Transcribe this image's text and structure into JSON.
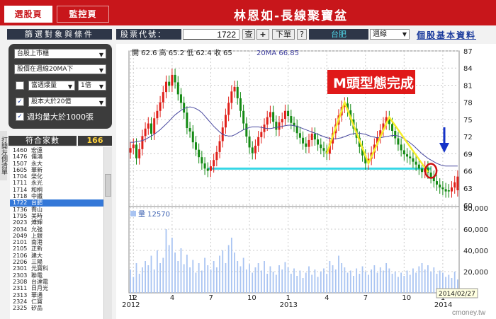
{
  "tabs": {
    "home": "選股頁",
    "monitor": "監控頁"
  },
  "app_title": "林恩如-長線聚寶盆",
  "toolbar": {
    "filter_header": "篩選對象與條件",
    "stock_label": "股票代號：",
    "stock_code": "1722",
    "query_button": "查",
    "add_button": "+",
    "order_button": "下單",
    "help_button": "?",
    "stock_name": "台肥",
    "period": "週線",
    "info_link": "個股基本資料"
  },
  "filters": {
    "market": "台股上市櫃",
    "price_condition": "股價在週線20MA下",
    "volume_option": "當週爆量",
    "volume_multiple": "1倍",
    "capital_option": "股本大於20億",
    "avg_volume_label": "週均量大於1000張"
  },
  "side_tab": "打開左側清單",
  "match": {
    "label": "符合家數",
    "count": "166"
  },
  "stock_list": [
    {
      "code": "1460",
      "name": "宏遠"
    },
    {
      "code": "1476",
      "name": "儒鴻"
    },
    {
      "code": "1507",
      "name": "永大"
    },
    {
      "code": "1605",
      "name": "華新"
    },
    {
      "code": "1704",
      "name": "榮化"
    },
    {
      "code": "1711",
      "name": "永光"
    },
    {
      "code": "1714",
      "name": "和桐"
    },
    {
      "code": "1718",
      "name": "中纖"
    },
    {
      "code": "1722",
      "name": "台肥"
    },
    {
      "code": "1736",
      "name": "喬山"
    },
    {
      "code": "1795",
      "name": "美時"
    },
    {
      "code": "2023",
      "name": "燁輝"
    },
    {
      "code": "2034",
      "name": "允強"
    },
    {
      "code": "2049",
      "name": "上銀"
    },
    {
      "code": "2101",
      "name": "南港"
    },
    {
      "code": "2105",
      "name": "正新"
    },
    {
      "code": "2106",
      "name": "建大"
    },
    {
      "code": "2206",
      "name": "三陽"
    },
    {
      "code": "2301",
      "name": "光寶科"
    },
    {
      "code": "2303",
      "name": "聯電"
    },
    {
      "code": "2308",
      "name": "台達電"
    },
    {
      "code": "2311",
      "name": "日月光"
    },
    {
      "code": "2313",
      "name": "華通"
    },
    {
      "code": "2324",
      "name": "仁寶"
    },
    {
      "code": "2325",
      "name": "矽品"
    }
  ],
  "selected_code": "1722",
  "quote": {
    "open": "開 62.6",
    "high": "高 65.2",
    "low": "低 62.4",
    "close": "收 65",
    "ma": "20MA 66.85"
  },
  "annotation": "M頭型態完成",
  "volume_label": "量 12570",
  "date_tooltip": "2014/02/27",
  "watermark": "cmoney.tw",
  "colors": {
    "up": "#e0201a",
    "down": "#138a13",
    "ma": "#4a4aa0",
    "support": "#36d7e6",
    "pattern": "#f5ee2a",
    "arrow": "#1533c8",
    "circle": "#cc1010",
    "volume": "#a9c4f2",
    "annotation_bg": "#e01919"
  },
  "chart_data": {
    "type": "candlestick",
    "price_axis": {
      "ticks": [
        60,
        63,
        66,
        69,
        72,
        75,
        78,
        81,
        84,
        87
      ],
      "range": [
        60,
        87
      ]
    },
    "volume_axis": {
      "ticks": [
        "0",
        "20,000",
        "40,000",
        "60,000",
        "80,000"
      ],
      "range": [
        0,
        80000
      ]
    },
    "x_tick_labels": [
      {
        "label": "12",
        "index": 0
      },
      {
        "label": "1",
        "index": 1
      },
      {
        "label": "4",
        "index": 14
      },
      {
        "label": "7",
        "index": 27
      },
      {
        "label": "10",
        "index": 40
      },
      {
        "label": "1",
        "index": 53
      },
      {
        "label": "4",
        "index": 66
      },
      {
        "label": "7",
        "index": 79
      },
      {
        "label": "10",
        "index": 92
      },
      {
        "label": "1",
        "index": 105
      }
    ],
    "year_labels": [
      {
        "label": "2012",
        "index": 0
      },
      {
        "label": "2013",
        "index": 53
      },
      {
        "label": "2014",
        "index": 105
      }
    ],
    "close": [
      70.0,
      70.6,
      68.2,
      69.8,
      72.1,
      73.4,
      74.3,
      72.5,
      75.2,
      76.5,
      78.0,
      79.8,
      81.6,
      80.9,
      82.8,
      81.5,
      79.4,
      77.9,
      76.2,
      73.5,
      72.9,
      71.0,
      69.7,
      68.4,
      67.3,
      66.4,
      66.0,
      66.8,
      67.9,
      69.3,
      71.2,
      73.6,
      75.8,
      77.9,
      79.9,
      80.7,
      78.7,
      76.5,
      74.3,
      72.0,
      70.1,
      69.1,
      70.4,
      71.9,
      72.8,
      74.1,
      75.4,
      76.3,
      74.6,
      73.2,
      74.5,
      75.1,
      76.5,
      75.6,
      74.4,
      73.9,
      72.6,
      71.8,
      70.8,
      70.2,
      71.4,
      72.5,
      71.5,
      70.6,
      70.0,
      69.5,
      69.0,
      70.8,
      72.6,
      74.1,
      75.7,
      77.2,
      77.8,
      76.6,
      75.0,
      73.4,
      71.8,
      70.2,
      68.7,
      67.3,
      68.1,
      69.2,
      70.6,
      71.9,
      73.1,
      74.3,
      75.4,
      74.2,
      73.0,
      71.7,
      70.6,
      69.6,
      68.9,
      68.5,
      68.2,
      67.6,
      67.1,
      66.4,
      65.8,
      66.6,
      65.7,
      64.9,
      64.2,
      63.6,
      63.1,
      62.8,
      62.4,
      62.4,
      63.1,
      64.0,
      65.0
    ],
    "open": [
      69.2,
      70.0,
      70.6,
      68.2,
      69.8,
      72.1,
      73.4,
      74.3,
      72.5,
      75.2,
      76.5,
      78.0,
      79.8,
      81.6,
      80.9,
      82.8,
      81.5,
      79.4,
      77.9,
      76.2,
      73.5,
      72.9,
      71.0,
      69.7,
      68.4,
      67.3,
      66.4,
      66.0,
      66.8,
      67.9,
      69.3,
      71.2,
      73.6,
      75.8,
      77.9,
      79.9,
      80.7,
      78.7,
      76.5,
      74.3,
      72.0,
      70.1,
      69.1,
      70.4,
      71.9,
      72.8,
      74.1,
      75.4,
      76.3,
      74.6,
      73.2,
      74.5,
      75.1,
      76.5,
      75.6,
      74.4,
      73.9,
      72.6,
      71.8,
      70.8,
      70.2,
      71.4,
      72.5,
      71.5,
      70.6,
      70.0,
      69.5,
      69.0,
      70.8,
      72.6,
      74.1,
      75.7,
      77.2,
      77.8,
      76.6,
      75.0,
      73.4,
      71.8,
      70.2,
      68.7,
      67.3,
      68.1,
      69.2,
      70.6,
      71.9,
      73.1,
      74.3,
      75.4,
      74.2,
      73.0,
      71.7,
      70.6,
      69.6,
      68.9,
      68.5,
      68.2,
      67.6,
      67.1,
      66.4,
      65.8,
      66.6,
      65.7,
      64.9,
      64.2,
      63.6,
      63.1,
      62.8,
      62.6,
      62.4,
      63.1,
      62.6
    ],
    "ma20": [
      71.0,
      71.0,
      71.1,
      71.2,
      71.3,
      71.5,
      71.8,
      72.1,
      72.4,
      72.8,
      73.2,
      73.7,
      74.2,
      74.7,
      75.3,
      75.8,
      76.2,
      76.6,
      76.9,
      77.1,
      77.2,
      77.1,
      76.9,
      76.6,
      76.2,
      75.6,
      75.0,
      74.4,
      73.8,
      73.3,
      72.8,
      72.4,
      72.2,
      72.1,
      72.1,
      72.3,
      72.6,
      72.9,
      73.2,
      73.4,
      73.6,
      73.7,
      73.7,
      73.7,
      73.6,
      73.5,
      73.4,
      73.4,
      73.5,
      73.6,
      73.7,
      73.8,
      73.9,
      74.0,
      74.0,
      73.9,
      73.8,
      73.6,
      73.4,
      73.2,
      73.0,
      72.8,
      72.6,
      72.4,
      72.2,
      72.0,
      71.8,
      71.7,
      71.6,
      71.6,
      71.7,
      71.8,
      72.0,
      72.2,
      72.4,
      72.5,
      72.6,
      72.6,
      72.5,
      72.4,
      72.2,
      72.0,
      71.9,
      71.8,
      71.8,
      71.9,
      72.0,
      72.1,
      72.2,
      72.2,
      72.1,
      71.9,
      71.6,
      71.3,
      70.9,
      70.5,
      70.0,
      69.5,
      69.0,
      68.6,
      68.2,
      67.9,
      67.6,
      67.3,
      67.1,
      66.9,
      66.85,
      66.85,
      66.85,
      66.85,
      66.85
    ],
    "volume": [
      22000,
      15000,
      28000,
      18000,
      24000,
      30000,
      26000,
      35000,
      22000,
      40000,
      28000,
      33000,
      60000,
      45000,
      52000,
      38000,
      30000,
      42000,
      27000,
      36000,
      24000,
      31000,
      19000,
      28000,
      21000,
      33000,
      26000,
      22000,
      30000,
      24000,
      35000,
      40000,
      28000,
      45000,
      52000,
      38000,
      30000,
      25000,
      33000,
      22000,
      27000,
      19000,
      24000,
      28000,
      21000,
      30000,
      18000,
      25000,
      20000,
      17000,
      26000,
      22000,
      29000,
      24000,
      18000,
      23000,
      16000,
      21000,
      14000,
      19000,
      25000,
      17000,
      22000,
      15000,
      20000,
      23000,
      18000,
      30000,
      26000,
      22000,
      35000,
      28000,
      24000,
      19000,
      21000,
      16000,
      23000,
      18000,
      25000,
      20000,
      17000,
      22000,
      26000,
      19000,
      24000,
      21000,
      28000,
      23000,
      18000,
      20000,
      15000,
      19000,
      16000,
      21000,
      17000,
      23000,
      19000,
      25000,
      28000,
      22000,
      26000,
      20000,
      24000,
      18000,
      21000,
      19000,
      15000,
      17000,
      14000,
      20000,
      12570
    ]
  }
}
